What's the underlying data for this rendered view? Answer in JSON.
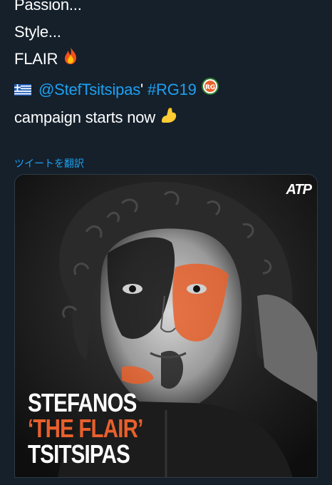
{
  "tweet": {
    "lines": [
      "Passion...",
      "Style...",
      "FLAIR"
    ],
    "mention": "@StefTsitsipas",
    "apostrophe": "'",
    "hashtag": "#RG19",
    "campaign_line": "campaign starts now",
    "emojis": [
      "fire-emoji",
      "greece-flag-emoji",
      "roland-garros-emoji",
      "flexed-biceps-emoji"
    ]
  },
  "translate_link": "ツイートを翻訳",
  "media": {
    "logo": "ATP",
    "caption": [
      "STEFANOS",
      "‘THE FLAIR’",
      "TSITSIPAS"
    ],
    "colors": {
      "caption_white": "#ffffff",
      "caption_orange": "#e8602c",
      "paint_orange": "#e8602c",
      "paint_black": "#1a1a1a"
    }
  },
  "colors": {
    "background": "#15202b",
    "link": "#1da1f2",
    "text": "#ffffff"
  }
}
